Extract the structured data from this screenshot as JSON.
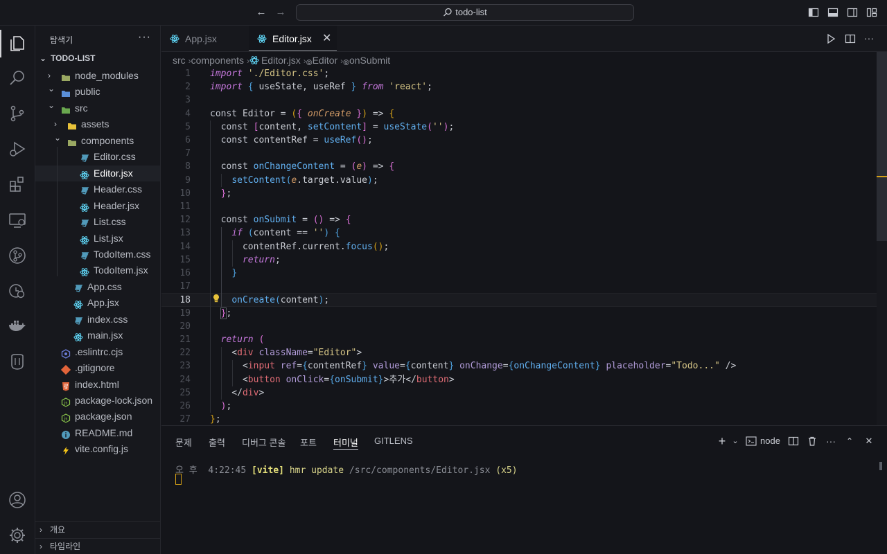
{
  "titlebar": {
    "search_text": "todo-list",
    "back_icon": "arrow-left-icon",
    "forward_icon": "arrow-right-icon"
  },
  "activity_bar": {
    "items": [
      "explorer-icon",
      "search-icon",
      "source-control-icon",
      "run-debug-icon",
      "extensions-icon",
      "remote-explorer-icon",
      "git-graph-icon",
      "timeline-icon",
      "docker-icon",
      "database-icon"
    ],
    "bottom": [
      "account-icon",
      "settings-gear-icon"
    ]
  },
  "sidebar": {
    "title": "탐색기",
    "more": "···",
    "root": "TODO-LIST",
    "items": [
      {
        "label": "node_modules",
        "depth": 1,
        "kind": "folder",
        "open": false
      },
      {
        "label": "public",
        "depth": 1,
        "kind": "folder",
        "open": true
      },
      {
        "label": "src",
        "depth": 1,
        "kind": "folder",
        "open": true
      },
      {
        "label": "assets",
        "depth": 2,
        "kind": "folder",
        "open": false
      },
      {
        "label": "components",
        "depth": 2,
        "kind": "folder",
        "open": true
      },
      {
        "label": "Editor.css",
        "depth": 3,
        "kind": "css"
      },
      {
        "label": "Editor.jsx",
        "depth": 3,
        "kind": "jsx",
        "selected": true
      },
      {
        "label": "Header.css",
        "depth": 3,
        "kind": "css"
      },
      {
        "label": "Header.jsx",
        "depth": 3,
        "kind": "jsx"
      },
      {
        "label": "List.css",
        "depth": 3,
        "kind": "css"
      },
      {
        "label": "List.jsx",
        "depth": 3,
        "kind": "jsx"
      },
      {
        "label": "TodoItem.css",
        "depth": 3,
        "kind": "css"
      },
      {
        "label": "TodoItem.jsx",
        "depth": 3,
        "kind": "jsx"
      },
      {
        "label": "App.css",
        "depth": 2,
        "kind": "css"
      },
      {
        "label": "App.jsx",
        "depth": 2,
        "kind": "jsx"
      },
      {
        "label": "index.css",
        "depth": 2,
        "kind": "css"
      },
      {
        "label": "main.jsx",
        "depth": 2,
        "kind": "jsx"
      },
      {
        "label": ".eslintrc.cjs",
        "depth": 1,
        "kind": "eslint"
      },
      {
        "label": ".gitignore",
        "depth": 1,
        "kind": "git"
      },
      {
        "label": "index.html",
        "depth": 1,
        "kind": "html"
      },
      {
        "label": "package-lock.json",
        "depth": 1,
        "kind": "node"
      },
      {
        "label": "package.json",
        "depth": 1,
        "kind": "node"
      },
      {
        "label": "README.md",
        "depth": 1,
        "kind": "info"
      },
      {
        "label": "vite.config.js",
        "depth": 1,
        "kind": "vite"
      }
    ],
    "sections": [
      {
        "label": "개요"
      },
      {
        "label": "타임라인"
      }
    ]
  },
  "tabs": [
    {
      "label": "App.jsx",
      "active": false
    },
    {
      "label": "Editor.jsx",
      "active": true
    }
  ],
  "tab_close": "✕",
  "breadcrumb": [
    "src",
    "components",
    "Editor.jsx",
    "Editor",
    "onSubmit"
  ],
  "editor": {
    "current_line": 18,
    "line_numbers": [
      "1",
      "2",
      "3",
      "4",
      "5",
      "6",
      "7",
      "8",
      "9",
      "10",
      "11",
      "12",
      "13",
      "14",
      "15",
      "16",
      "17",
      "18",
      "19",
      "20",
      "21",
      "22",
      "23",
      "24",
      "25",
      "26",
      "27"
    ]
  },
  "panel": {
    "tabs": [
      "문제",
      "출력",
      "디버그 콘솔",
      "포트",
      "터미널",
      "GITLENS"
    ],
    "active_tab": "터미널",
    "terminal_name": "node",
    "terminal": {
      "time": "오 후  4:22:45",
      "tag": "[vite]",
      "message": "hmr update",
      "path": "/src/components/Editor.jsx",
      "count": "(x5)"
    }
  },
  "colors": {
    "accent_yellow": "#d4a017",
    "react_blue": "#61dafb",
    "css_blue": "#519aba"
  }
}
